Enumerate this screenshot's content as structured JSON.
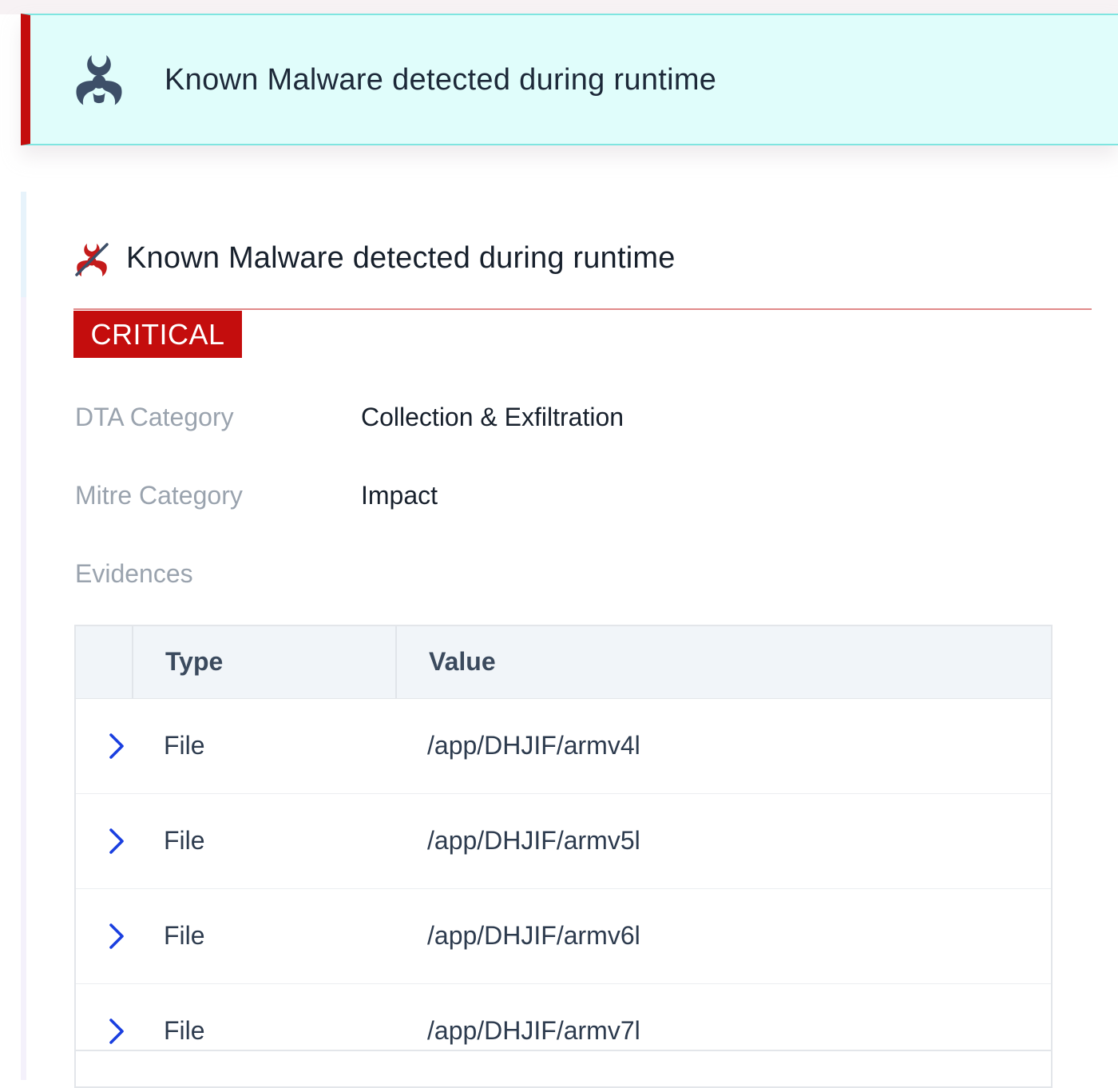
{
  "banner": {
    "title": "Known Malware detected during runtime",
    "icon": "biohazard-icon",
    "accent_color": "#c40d0d",
    "background_color": "#e0fdfb"
  },
  "panel": {
    "title": "Known Malware detected during runtime",
    "icon": "biohazard-crossed-icon",
    "severity": "CRITICAL",
    "severity_color": "#c40d0d",
    "fields": {
      "dta_category": {
        "label": "DTA Category",
        "value": "Collection & Exfiltration"
      },
      "mitre_category": {
        "label": "Mitre Category",
        "value": "Impact"
      }
    },
    "evidences_label": "Evidences"
  },
  "evidences": {
    "columns": [
      "Type",
      "Value"
    ],
    "rows": [
      {
        "type": "File",
        "value": "/app/DHJIF/armv4l"
      },
      {
        "type": "File",
        "value": "/app/DHJIF/armv5l"
      },
      {
        "type": "File",
        "value": "/app/DHJIF/armv6l"
      },
      {
        "type": "File",
        "value": "/app/DHJIF/armv7l"
      }
    ],
    "expand_icon": "chevron-right-icon",
    "chevron_color": "#1a3fe0"
  }
}
